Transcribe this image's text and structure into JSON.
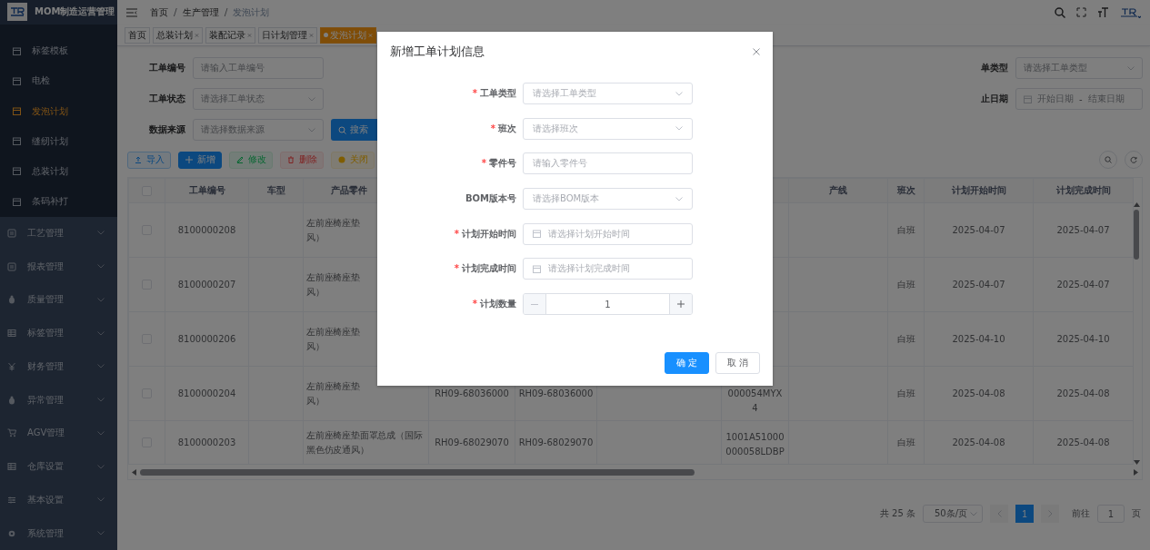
{
  "sidebar": {
    "title": "MOM制造运营管理",
    "items": [
      {
        "label": "标签模板",
        "selected": false
      },
      {
        "label": "电检",
        "selected": false
      },
      {
        "label": "发泡计划",
        "selected": true
      },
      {
        "label": "缝纫计划",
        "selected": false
      },
      {
        "label": "总装计划",
        "selected": false
      },
      {
        "label": "条码补打",
        "selected": false
      }
    ],
    "groups": [
      {
        "label": "工艺管理"
      },
      {
        "label": "报表管理"
      },
      {
        "label": "质量管理"
      },
      {
        "label": "标签管理"
      },
      {
        "label": "财务管理"
      },
      {
        "label": "异常管理"
      },
      {
        "label": "AGV管理"
      },
      {
        "label": "仓库设置"
      },
      {
        "label": "基本设置"
      },
      {
        "label": "系统管理"
      }
    ]
  },
  "breadcrumb": {
    "items": [
      "首页",
      "生产管理",
      "发泡计划"
    ],
    "separator": "/"
  },
  "tags": [
    {
      "label": "首页",
      "closable": false,
      "selected": false
    },
    {
      "label": "总装计划",
      "closable": true,
      "selected": false
    },
    {
      "label": "装配记录",
      "closable": true,
      "selected": false
    },
    {
      "label": "日计划管理",
      "closable": true,
      "selected": false
    },
    {
      "label": "发泡计划",
      "closable": true,
      "selected": true
    }
  ],
  "filters": {
    "left": [
      {
        "label": "工单编号",
        "kind": "input",
        "placeholder": "请输入工单编号"
      },
      {
        "label": "工单状态",
        "kind": "select",
        "placeholder": "请选择工单状态"
      },
      {
        "label": "数据来源",
        "kind": "select",
        "placeholder": "请选择数据来源"
      }
    ],
    "search_button": "搜索",
    "right": [
      {
        "label": "单类型",
        "kind": "select",
        "placeholder": "请选择工单类型"
      },
      {
        "label": "止日期",
        "kind": "daterange",
        "placeholder": "开始日期",
        "separator": "-",
        "end_placeholder": "结束日期"
      }
    ]
  },
  "toolbar": [
    {
      "label": "导入",
      "kind": "import"
    },
    {
      "label": "新增",
      "kind": "add"
    },
    {
      "label": "修改",
      "kind": "edit"
    },
    {
      "label": "删除",
      "kind": "delete"
    },
    {
      "label": "关闭",
      "kind": "close"
    }
  ],
  "table": {
    "all_checked": false,
    "columns": {
      "order_no": "工单编号",
      "car_model": "车型",
      "product": "产品零件",
      "line": "产线",
      "shift": "班次",
      "start": "计划开始时间",
      "end": "计划完成时间"
    },
    "rows": [
      {
        "checked": false,
        "order_no": "8100000208",
        "product": [
          "左前座椅座垫",
          "风）"
        ],
        "shift": "白班",
        "start": "2025-04-07",
        "end": "2025-04-07"
      },
      {
        "checked": false,
        "order_no": "8100000207",
        "product": [
          "左前座椅座垫",
          "风）"
        ],
        "shift": "白班",
        "start": "2025-04-07",
        "end": "2025-04-07"
      },
      {
        "checked": false,
        "order_no": "8100000206",
        "product": [
          "左前座椅座垫",
          "风）"
        ],
        "shift": "白班",
        "start": "2025-04-10",
        "end": "2025-04-10"
      },
      {
        "checked": false,
        "order_no": "8100000204",
        "product": [
          "左前座椅座垫",
          "风）"
        ],
        "column_5": "RH09-68036000",
        "column_6": "RH09-68036000",
        "column_8": [
          "000054MYX",
          "4"
        ],
        "shift": "白班",
        "start": "2025-04-08",
        "end": "2025-04-08"
      },
      {
        "checked": false,
        "order_no": "8100000203",
        "product": [
          "左前座椅座垫面罩总成（国际",
          "黑色仿皮通风）"
        ],
        "column_5": "RH09-68029070",
        "column_6": "RH09-68029070",
        "column_8": [
          "1001A51000",
          "000058LDBP"
        ],
        "shift": "白班",
        "start": "2025-04-08",
        "end": "2025-04-08"
      }
    ]
  },
  "pagination": {
    "total": "共 25 条",
    "page_size": "50条/页",
    "pages": [
      {
        "label": "1",
        "selected": true
      }
    ],
    "goto_label": "前往",
    "goto_value": "1",
    "page_unit": "页"
  },
  "dialog": {
    "title": "新增工单计划信息",
    "fields": [
      {
        "label": "工单类型",
        "required_mark": "*",
        "kind": "select",
        "placeholder": "请选择工单类型"
      },
      {
        "label": "班次",
        "required_mark": "*",
        "kind": "select",
        "placeholder": "请选择班次"
      },
      {
        "label": "零件号",
        "required_mark": "*",
        "kind": "input",
        "placeholder": "请输入零件号"
      },
      {
        "label": "BOM版本号",
        "kind": "select",
        "placeholder": "请选择BOM版本"
      },
      {
        "label": "计划开始时间",
        "required_mark": "*",
        "kind": "date",
        "placeholder": "请选择计划开始时间"
      },
      {
        "label": "计划完成时间",
        "required_mark": "*",
        "kind": "date",
        "placeholder": "请选择计划完成时间"
      },
      {
        "label": "计划数量",
        "required_mark": "*",
        "kind": "number",
        "value": "1"
      }
    ],
    "buttons": [
      {
        "label": "确 定",
        "kind": "primary"
      },
      {
        "label": "取 消",
        "kind": "default"
      }
    ]
  }
}
